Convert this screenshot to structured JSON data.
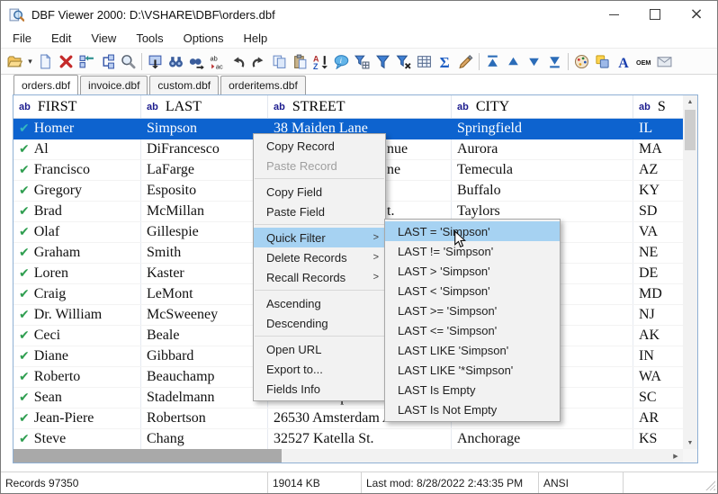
{
  "window": {
    "title": "DBF Viewer 2000: D:\\VSHARE\\DBF\\orders.dbf"
  },
  "menubar": {
    "items": [
      "File",
      "Edit",
      "View",
      "Tools",
      "Options",
      "Help"
    ]
  },
  "toolbar": {
    "icons": [
      "open-file",
      "open-dropdown",
      "new-file",
      "delete-record",
      "goto-record",
      "fields-structure",
      "zoom",
      "|",
      "export-save",
      "find",
      "find-next",
      "replace",
      "undo",
      "redo",
      "copy",
      "paste",
      "sort-az",
      "comment",
      "filter-builder",
      "set-filter",
      "clear-filter",
      "grid-view",
      "sum",
      "brush",
      "|",
      "first-record",
      "prior-record",
      "next-record",
      "last-record",
      "|",
      "color-palette",
      "appearance",
      "font",
      "oem-charset",
      "send-mail"
    ]
  },
  "tabs": [
    {
      "label": "orders.dbf",
      "active": true
    },
    {
      "label": "invoice.dbf",
      "active": false
    },
    {
      "label": "custom.dbf",
      "active": false
    },
    {
      "label": "orderitems.dbf",
      "active": false
    }
  ],
  "table": {
    "columns": [
      {
        "type": "ab",
        "label": "FIRST"
      },
      {
        "type": "ab",
        "label": "LAST"
      },
      {
        "type": "ab",
        "label": "STREET"
      },
      {
        "type": "ab",
        "label": "CITY"
      },
      {
        "type": "ab",
        "label": "S"
      }
    ],
    "rows": [
      {
        "first": "Homer",
        "last": "Simpson",
        "street": "38 Maiden Lane",
        "city": "Springfield",
        "state": "IL",
        "selected": true
      },
      {
        "first": "Al",
        "last": "DiFrancesco",
        "street": "nue",
        "street_clipped": true,
        "city": "Aurora",
        "state": "MA"
      },
      {
        "first": "Francisco",
        "last": "LaFarge",
        "street": "ne",
        "street_clipped": true,
        "city": "Temecula",
        "state": "AZ"
      },
      {
        "first": "Gregory",
        "last": "Esposito",
        "street": "",
        "city": "Buffalo",
        "state": "KY"
      },
      {
        "first": "Brad",
        "last": "McMillan",
        "street": "t.",
        "street_clipped": true,
        "city": "Taylors",
        "state": "SD"
      },
      {
        "first": "Olaf",
        "last": "Gillespie",
        "street": "",
        "city": "",
        "state": "VA"
      },
      {
        "first": "Graham",
        "last": "Smith",
        "street": "",
        "city": "",
        "state": "NE"
      },
      {
        "first": "Loren",
        "last": "Kaster",
        "street": "",
        "city": "",
        "state": "DE"
      },
      {
        "first": "Craig",
        "last": "LeMont",
        "street": "",
        "city": "",
        "state": "MD"
      },
      {
        "first": "Dr. William",
        "last": "McSweeney",
        "street": "",
        "city": "",
        "state": "NJ"
      },
      {
        "first": "Ceci",
        "last": "Beale",
        "street": "",
        "city": "",
        "state": "AK"
      },
      {
        "first": "Diane",
        "last": "Gibbard",
        "street": "",
        "city": "",
        "state": "IN"
      },
      {
        "first": "Roberto",
        "last": "Beauchamp",
        "street": "",
        "city": "",
        "state": "WA"
      },
      {
        "first": "Sean",
        "last": "Stadelmann",
        "street": "19620 Newport Ro",
        "city": "",
        "state": "SC"
      },
      {
        "first": "Jean-Piere",
        "last": "Robertson",
        "street": "26530 Amsterdam A",
        "city": "",
        "state": "AR"
      },
      {
        "first": "Steve",
        "last": "Chang",
        "street": "32527 Katella St.",
        "city": "Anchorage",
        "state": "KS"
      }
    ]
  },
  "context_menu": {
    "items": [
      {
        "label": "Copy Record"
      },
      {
        "label": "Paste Record",
        "disabled": true
      },
      {
        "type": "sep"
      },
      {
        "label": "Copy Field"
      },
      {
        "label": "Paste Field"
      },
      {
        "type": "sep"
      },
      {
        "label": "Quick Filter",
        "submenu": true,
        "highlighted": true
      },
      {
        "label": "Delete Records",
        "submenu": true
      },
      {
        "label": "Recall Records",
        "submenu": true
      },
      {
        "type": "sep"
      },
      {
        "label": "Ascending"
      },
      {
        "label": "Descending"
      },
      {
        "type": "sep"
      },
      {
        "label": "Open URL"
      },
      {
        "label": "Export to..."
      },
      {
        "label": "Fields Info"
      }
    ]
  },
  "quick_filter_submenu": {
    "items": [
      {
        "label": "LAST = 'Simpson'",
        "highlighted": true
      },
      {
        "label": "LAST != 'Simpson'"
      },
      {
        "label": "LAST > 'Simpson'"
      },
      {
        "label": "LAST < 'Simpson'"
      },
      {
        "label": "LAST >= 'Simpson'"
      },
      {
        "label": "LAST <= 'Simpson'"
      },
      {
        "label": "LAST LIKE 'Simpson'"
      },
      {
        "label": "LAST LIKE '*Simpson'"
      },
      {
        "label": "LAST Is Empty"
      },
      {
        "label": "LAST Is Not Empty"
      }
    ]
  },
  "statusbar": {
    "cells": [
      "Records 97350",
      "19014 KB",
      "Last mod: 8/28/2022 2:43:35 PM",
      "ANSI",
      ""
    ]
  },
  "icons": {
    "record_check": "✔",
    "submenu_arrow": ">",
    "dropdown_caret": "▾"
  },
  "colors": {
    "selection": "#0d63cf",
    "menu_highlight": "#a6d2f2",
    "check_green": "#2f9e50",
    "field_type_navy": "#1b1b8e"
  }
}
